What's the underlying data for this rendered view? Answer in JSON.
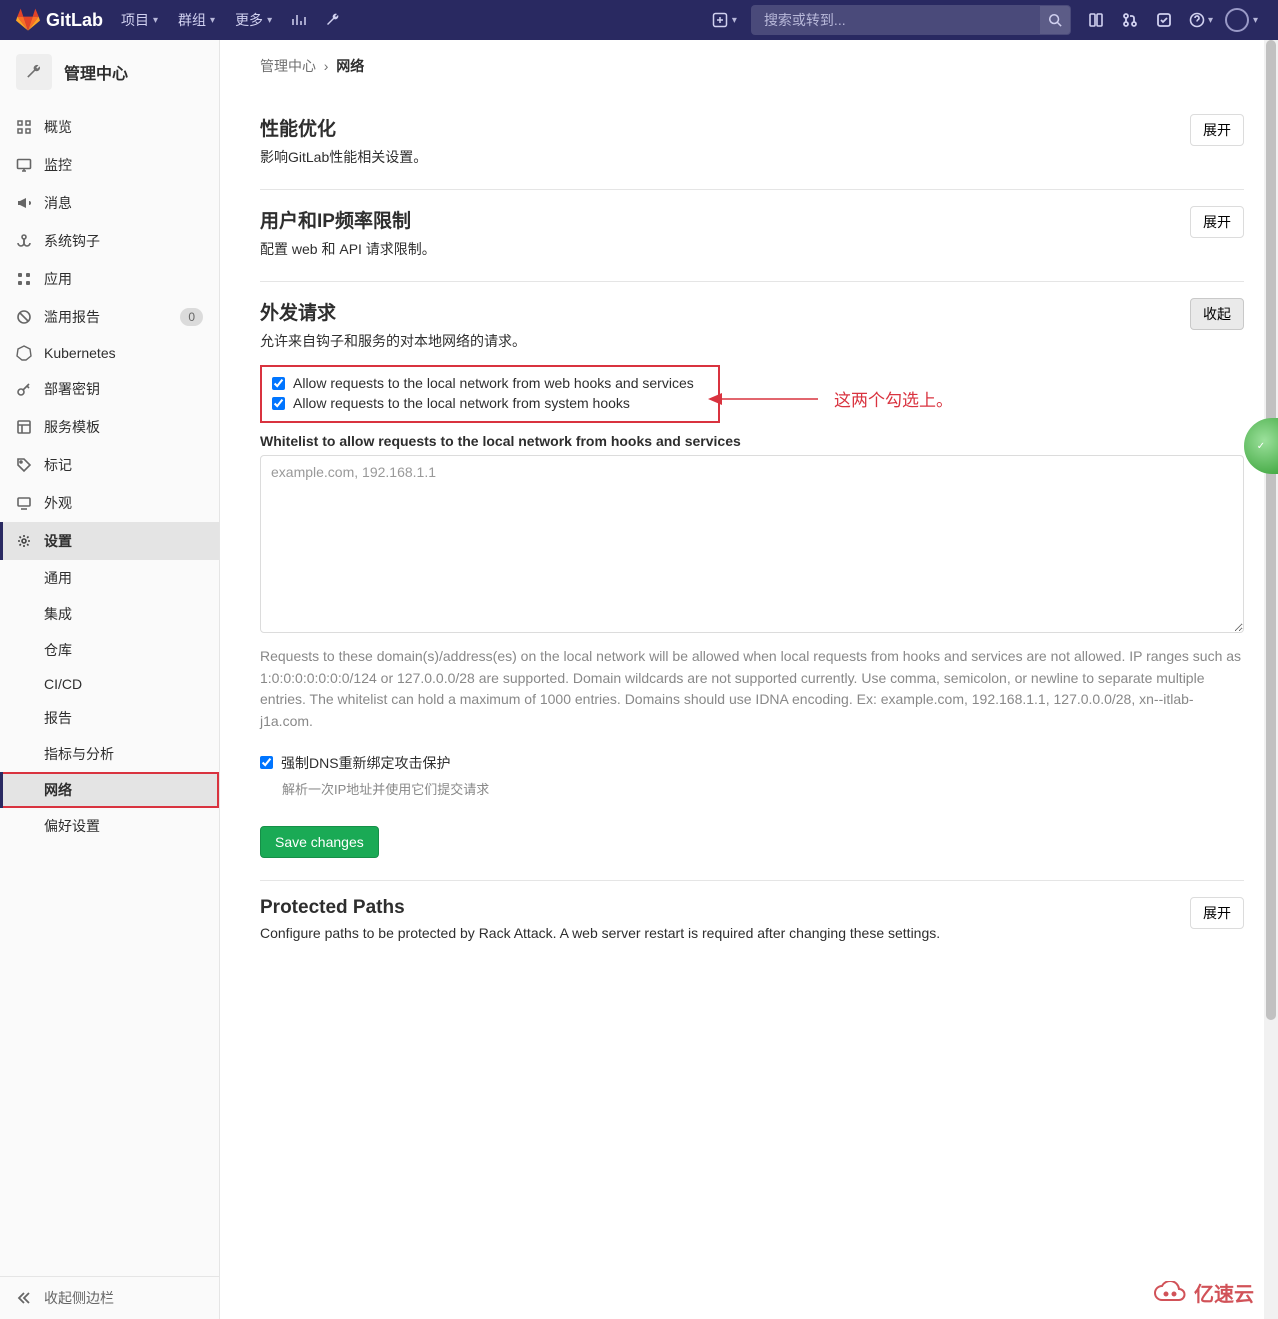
{
  "brand": "GitLab",
  "header": {
    "nav": [
      "项目",
      "群组",
      "更多"
    ],
    "search_placeholder": "搜索或转到..."
  },
  "sidebar": {
    "title": "管理中心",
    "items": [
      {
        "label": "概览",
        "icon": "overview"
      },
      {
        "label": "监控",
        "icon": "monitor"
      },
      {
        "label": "消息",
        "icon": "bullhorn"
      },
      {
        "label": "系统钩子",
        "icon": "hook"
      },
      {
        "label": "应用",
        "icon": "apps"
      },
      {
        "label": "滥用报告",
        "icon": "spam",
        "badge": "0"
      },
      {
        "label": "Kubernetes",
        "icon": "kube"
      },
      {
        "label": "部署密钥",
        "icon": "key"
      },
      {
        "label": "服务模板",
        "icon": "template"
      },
      {
        "label": "标记",
        "icon": "labels"
      },
      {
        "label": "外观",
        "icon": "appearance"
      },
      {
        "label": "设置",
        "icon": "settings",
        "active": true
      }
    ],
    "subs": [
      "通用",
      "集成",
      "仓库",
      "CI/CD",
      "报告",
      "指标与分析",
      "网络",
      "偏好设置"
    ],
    "active_sub": "网络",
    "collapse": "收起侧边栏"
  },
  "breadcrumbs": {
    "parent": "管理中心",
    "current": "网络"
  },
  "sections": {
    "perf": {
      "title": "性能优化",
      "desc": "影响GitLab性能相关设置。",
      "btn": "展开"
    },
    "rate": {
      "title": "用户和IP频率限制",
      "desc": "配置 web 和 API 请求限制。",
      "btn": "展开"
    },
    "outbound": {
      "title": "外发请求",
      "desc": "允许来自钩子和服务的对本地网络的请求。",
      "btn": "收起",
      "chk1": "Allow requests to the local network from web hooks and services",
      "chk2": "Allow requests to the local network from system hooks",
      "whitelist_label": "Whitelist to allow requests to the local network from hooks and services",
      "whitelist_placeholder": "example.com, 192.168.1.1",
      "whitelist_help": "Requests to these domain(s)/address(es) on the local network will be allowed when local requests from hooks and services are not allowed. IP ranges such as 1:0:0:0:0:0:0:0/124 or 127.0.0.0/28 are supported. Domain wildcards are not supported currently. Use comma, semicolon, or newline to separate multiple entries. The whitelist can hold a maximum of 1000 entries. Domains should use IDNA encoding. Ex: example.com, 192.168.1.1, 127.0.0.0/28, xn--itlab-j1a.com.",
      "dns_label": "强制DNS重新绑定攻击保护",
      "dns_help": "解析一次IP地址并使用它们提交请求",
      "save": "Save changes"
    },
    "protected": {
      "title": "Protected Paths",
      "desc": "Configure paths to be protected by Rack Attack. A web server restart is required after changing these settings.",
      "btn": "展开"
    }
  },
  "annotation": "这两个勾选上。",
  "watermark": "亿速云"
}
